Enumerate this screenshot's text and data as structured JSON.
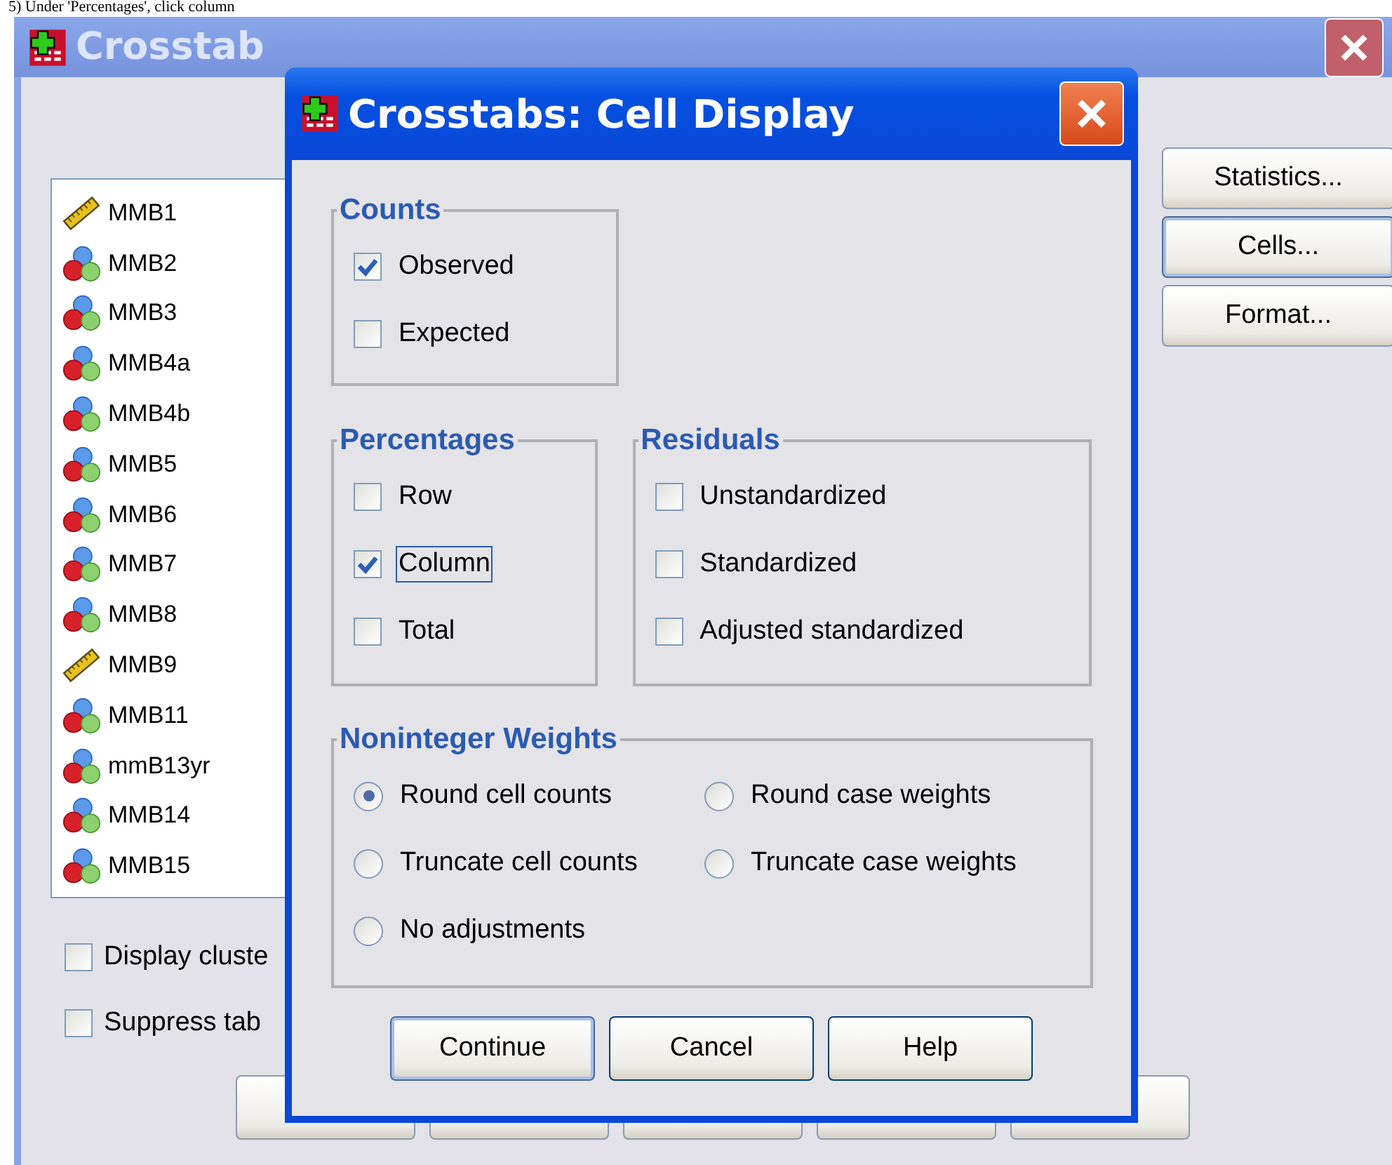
{
  "caption": "5) Under 'Percentages', click column",
  "main_window": {
    "title": "Crosstab",
    "variables": [
      {
        "name": "MMB1",
        "kind": "scale"
      },
      {
        "name": "MMB2",
        "kind": "nominal"
      },
      {
        "name": "MMB3",
        "kind": "nominal"
      },
      {
        "name": "MMB4a",
        "kind": "nominal"
      },
      {
        "name": "MMB4b",
        "kind": "nominal"
      },
      {
        "name": "MMB5",
        "kind": "nominal"
      },
      {
        "name": "MMB6",
        "kind": "nominal"
      },
      {
        "name": "MMB7",
        "kind": "nominal"
      },
      {
        "name": "MMB8",
        "kind": "nominal"
      },
      {
        "name": "MMB9",
        "kind": "scale"
      },
      {
        "name": "MMB11",
        "kind": "nominal"
      },
      {
        "name": "mmB13yr",
        "kind": "nominal"
      },
      {
        "name": "MMB14",
        "kind": "nominal"
      },
      {
        "name": "MMB15",
        "kind": "nominal"
      }
    ],
    "side_buttons": [
      {
        "label": "Statistics...",
        "selected": false
      },
      {
        "label": "Cells...",
        "selected": true
      },
      {
        "label": "Format...",
        "selected": false
      }
    ],
    "options": [
      {
        "label": "Display cluste",
        "checked": false
      },
      {
        "label": "Suppress tab",
        "checked": false
      }
    ]
  },
  "dialog": {
    "title": "Crosstabs: Cell Display",
    "counts": {
      "title": "Counts",
      "options": [
        {
          "label": "Observed",
          "checked": true,
          "focused": false
        },
        {
          "label": "Expected",
          "checked": false,
          "focused": false
        }
      ]
    },
    "percentages": {
      "title": "Percentages",
      "options": [
        {
          "label": "Row",
          "checked": false,
          "focused": false
        },
        {
          "label": "Column",
          "checked": true,
          "focused": true
        },
        {
          "label": "Total",
          "checked": false,
          "focused": false
        }
      ]
    },
    "residuals": {
      "title": "Residuals",
      "options": [
        {
          "label": "Unstandardized",
          "checked": false,
          "focused": false
        },
        {
          "label": "Standardized",
          "checked": false,
          "focused": false
        },
        {
          "label": "Adjusted standardized",
          "checked": false,
          "focused": false
        }
      ]
    },
    "weights": {
      "title": "Noninteger Weights",
      "options": [
        {
          "label": "Round cell counts",
          "selected": true
        },
        {
          "label": "Round case weights",
          "selected": false
        },
        {
          "label": "Truncate cell counts",
          "selected": false
        },
        {
          "label": "Truncate case weights",
          "selected": false
        },
        {
          "label": "No adjustments",
          "selected": false
        }
      ]
    },
    "buttons": [
      {
        "label": "Continue",
        "default": true
      },
      {
        "label": "Cancel",
        "default": false
      },
      {
        "label": "Help",
        "default": false
      }
    ]
  }
}
